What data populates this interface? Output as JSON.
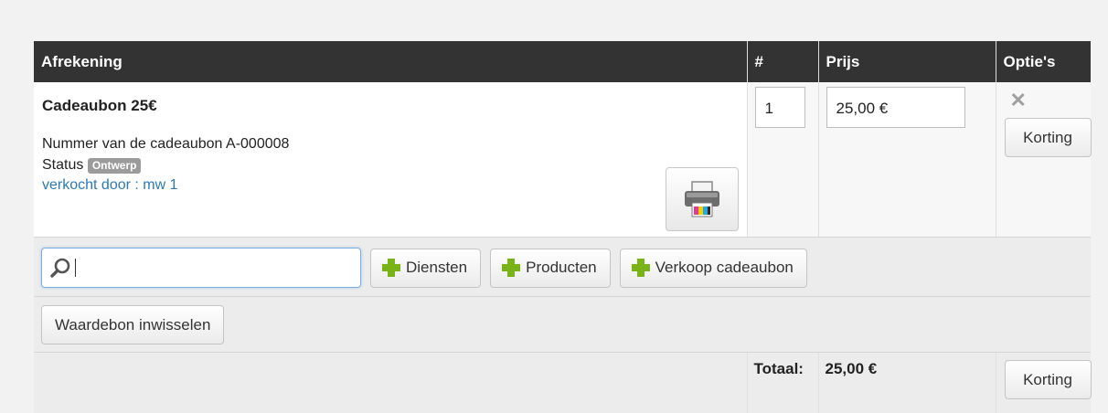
{
  "header": {
    "col_checkout": "Afrekening",
    "col_qty": "#",
    "col_price": "Prijs",
    "col_options": "Optie's"
  },
  "item": {
    "title": "Cadeaubon 25€",
    "number_line": "Nummer van de cadeaubon A-000008",
    "status_label": "Status",
    "status_badge": "Ontwerp",
    "seller": "verkocht door : mw 1",
    "quantity": "1",
    "price": "25,00 €",
    "discount_label": "Korting"
  },
  "toolbar": {
    "search_value": "",
    "services_label": "Diensten",
    "products_label": "Producten",
    "sell_voucher_label": "Verkoop cadeaubon",
    "redeem_label": "Waardebon inwisselen"
  },
  "totals": {
    "label": "Totaal:",
    "value": "25,00 €",
    "discount_label": "Korting"
  }
}
